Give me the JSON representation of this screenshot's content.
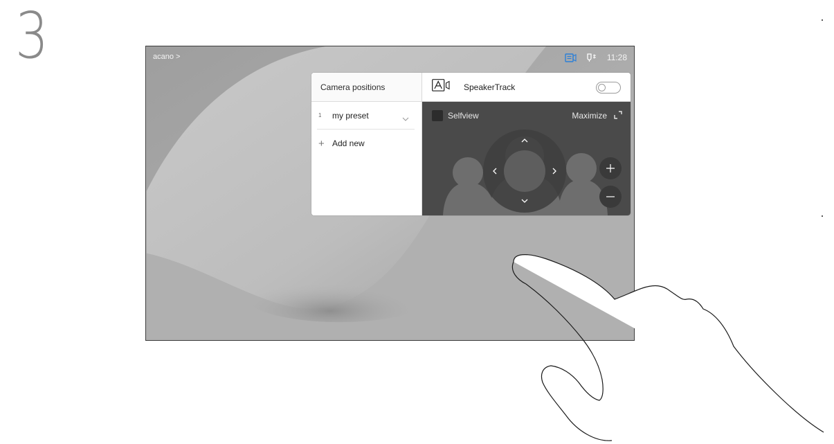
{
  "step": {
    "number": "3"
  },
  "screen": {
    "header": {
      "left_label": "acano >",
      "clock": "11:28"
    },
    "icons": {
      "header_left": "share-screen-icon",
      "header_right": "microphone-icon"
    }
  },
  "camera_panel": {
    "presets": {
      "title": "Camera positions",
      "items": [
        {
          "index": "1",
          "name": "my preset"
        }
      ],
      "add_label": "Add new"
    },
    "speakertrack": {
      "label": "SpeakerTrack",
      "enabled": false
    },
    "preview": {
      "selfview_label": "Selfview",
      "maximize_label": "Maximize",
      "zoom_in": "+",
      "zoom_out": "−"
    }
  },
  "colors": {
    "accent_blue": "#2b7fd8",
    "screen_bg": "#b2b2b2",
    "preview_bg": "#4a4a4a"
  }
}
